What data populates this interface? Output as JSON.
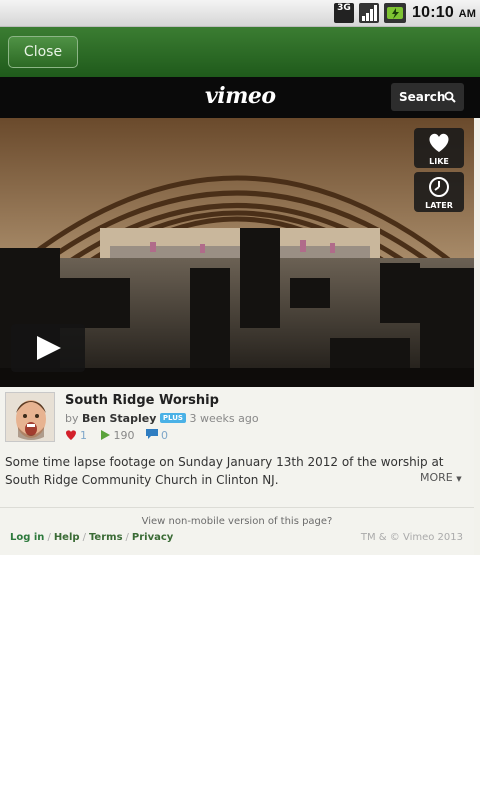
{
  "status_bar": {
    "network": "3G",
    "time": "10:10",
    "ampm": "AM"
  },
  "top_bar": {
    "close_label": "Close"
  },
  "header": {
    "logo": "vimeo",
    "search_label": "Search"
  },
  "video": {
    "like_label": "LIKE",
    "later_label": "LATER",
    "icons": [
      "play-icon",
      "heart-icon",
      "clock-icon"
    ]
  },
  "info": {
    "title": "South Ridge Worship",
    "by": "by",
    "author": "Ben Stapley",
    "badge": "PLUS",
    "age": "3 weeks ago",
    "likes": "1",
    "plays": "190",
    "comments": "0",
    "description": "Some time lapse footage on Sunday January 13th 2012 of the worship at South Ridge Community Church in Clinton NJ.",
    "more_label": "MORE"
  },
  "footer": {
    "non_mobile": "View non-mobile version of this page?",
    "links": [
      "Log in",
      "Help",
      "Terms",
      "Privacy"
    ],
    "copyright": "TM & © Vimeo 2013"
  },
  "colors": {
    "green_bar": "#2d6a26",
    "header_bg": "#0a0a0a",
    "plus_badge": "#4ab1e6",
    "like_red": "#d3202a",
    "play_green": "#5aa33a",
    "comment_blue": "#2f7dc1"
  }
}
